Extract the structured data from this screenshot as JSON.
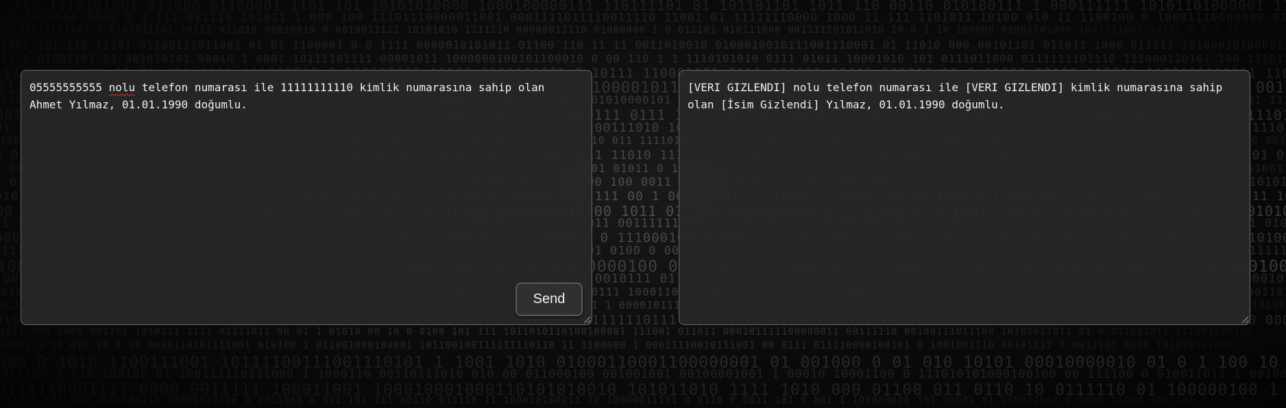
{
  "input_panel": {
    "text_part_1": "05555555555 ",
    "text_misspelled": "nolu",
    "text_part_2": " telefon numarası ile 11111111110 kimlik numarasına sahip olan Ahmet Yılmaz, 01.01.1990 doğumlu.",
    "send_label": "Send"
  },
  "output_panel": {
    "text": "[VERI GIZLENDI] nolu telefon numarası ile [VERI GIZLENDI] kimlik numarasına sahip olan [İsim Gizlendi] Yılmaz, 01.01.1990 doğumlu."
  },
  "colors": {
    "background": "#050505",
    "panel_bg": "#262727",
    "panel_border": "#6e6e6e",
    "text": "#f2f2f2",
    "spellcheck_underline": "#e03030"
  },
  "icons": {
    "resize_handle": "resize-grip-icon"
  }
}
